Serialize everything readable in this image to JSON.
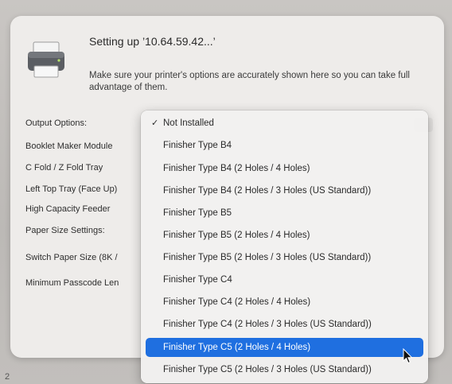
{
  "dialog": {
    "title": "Setting up ’10.64.59.42...’",
    "description": "Make sure your printer's options are accurately shown here so you can take full advantage of them.",
    "printer_icon": "printer-icon"
  },
  "options": {
    "labels": [
      "Output Options:",
      "Booklet Maker Module",
      "C Fold / Z Fold Tray",
      "Left Top Tray (Face Up)",
      "High Capacity Feeder",
      "Paper Size Settings:",
      "Switch Paper Size (8K /",
      "Minimum Passcode Len"
    ]
  },
  "dropdown": {
    "checkmark": "✓",
    "items": [
      "Not Installed",
      "Finisher Type B4",
      "Finisher Type B4 (2 Holes / 4 Holes)",
      "Finisher Type B4 (2 Holes / 3 Holes (US Standard))",
      "Finisher Type B5",
      "Finisher Type B5 (2 Holes / 4 Holes)",
      "Finisher Type B5 (2 Holes / 3 Holes (US Standard))",
      "Finisher Type C4",
      "Finisher Type C4 (2 Holes / 4 Holes)",
      "Finisher Type C4 (2 Holes / 3 Holes (US Standard))",
      "Finisher Type C5 (2 Holes / 4 Holes)",
      "Finisher Type C5 (2 Holes / 3 Holes (US Standard))"
    ],
    "checked_item": "Not Installed",
    "highlighted_item": "Finisher Type C5 (2 Holes / 4 Holes)",
    "highlight_color": "#1f6fe0"
  },
  "footer": {
    "corner_text": "2"
  }
}
